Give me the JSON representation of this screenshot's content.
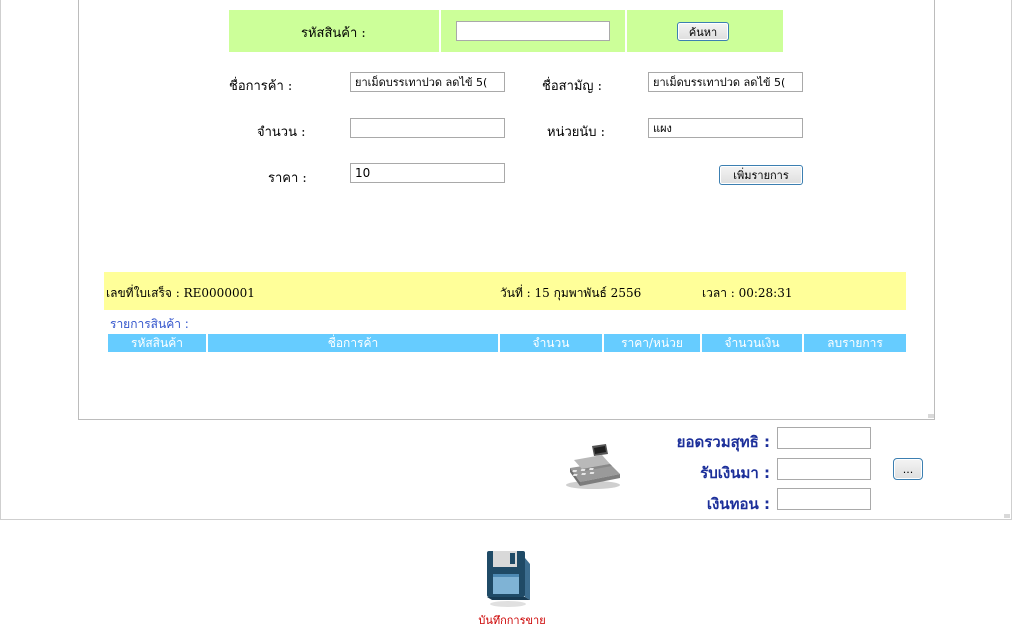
{
  "search": {
    "label": "รหัสสินค้า :",
    "value": "",
    "button": "ค้นหา"
  },
  "form": {
    "trade_name_label": "ชื่อการค้า :",
    "trade_name_value": "ยาเม็ดบรรเทาปวด ลดไข้ 5(",
    "generic_name_label": "ชื่อสามัญ :",
    "generic_name_value": "ยาเม็ดบรรเทาปวด ลดไข้ 5(",
    "qty_label": "จำนวน :",
    "qty_value": "",
    "unit_label": "หน่วยนับ :",
    "unit_value": "แผง",
    "price_label": "ราคา :",
    "price_value": "10",
    "add_button": "เพิ่มรายการ"
  },
  "receipt": {
    "no_label": "เลขที่ใบเสร็จ : RE0000001",
    "date_label": "วันที่ : 15 กุมพาพันธ์ 2556",
    "time_label": "เวลา : 00:28:31"
  },
  "items": {
    "caption": "รายการสินค้า :",
    "columns": [
      "รหัสสินค้า",
      "ชื่อการค้า",
      "จำนวน",
      "ราคา/หน่วย",
      "จำนวนเงิน",
      "ลบรายการ"
    ]
  },
  "totals": {
    "net_label": "ยอดรวมสุทธิ :",
    "net_value": "",
    "received_label": "รับเงินมา :",
    "received_value": "",
    "change_label": "เงินทอน :",
    "change_value": "",
    "calc_button": "..."
  },
  "save": {
    "label": "บันทึกการขาย"
  },
  "colors": {
    "search_bg": "#ccff99",
    "receipt_bg": "#ffff99",
    "header_bg": "#66ccff",
    "totals_text": "#1c2f9a",
    "save_text": "#cc0000"
  }
}
